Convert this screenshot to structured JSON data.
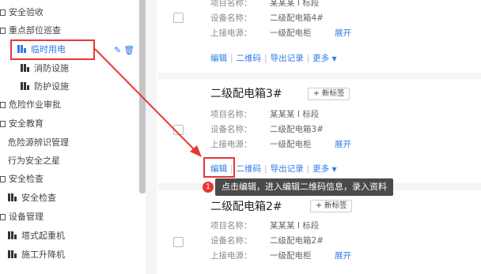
{
  "sidebar": {
    "items": [
      {
        "label": "安全验收",
        "kind": "group"
      },
      {
        "label": "重点部位巡查",
        "kind": "group"
      },
      {
        "label": "临时用电",
        "kind": "sub",
        "active": true
      },
      {
        "label": "消防设施",
        "kind": "sub"
      },
      {
        "label": "防护设施",
        "kind": "sub"
      },
      {
        "label": "危险作业审批",
        "kind": "group"
      },
      {
        "label": "安全教育",
        "kind": "group"
      },
      {
        "label": "危险源辨识管理",
        "kind": "plain"
      },
      {
        "label": "行为安全之星",
        "kind": "plain"
      },
      {
        "label": "安全检查",
        "kind": "group"
      },
      {
        "label": "安全检查",
        "kind": "sub"
      },
      {
        "label": "设备管理",
        "kind": "group"
      },
      {
        "label": "塔式起重机",
        "kind": "sub"
      },
      {
        "label": "施工升降机",
        "kind": "sub"
      }
    ],
    "item_actions": {
      "edit_icon": "pen-icon",
      "delete_icon": "trash-icon"
    }
  },
  "field_labels": {
    "project": "项目名称：",
    "device": "设备名称：",
    "upstream": "上接电源："
  },
  "cards": [
    {
      "title": "",
      "project": "某某某 I 标段",
      "device": "二级配电箱4#",
      "upstream": "一级配电柜",
      "expand": "展开",
      "actions": [
        "编辑",
        "二维码",
        "导出记录",
        "更多"
      ]
    },
    {
      "title": "二级配电箱3#",
      "tag_button": "+ 新标签",
      "project": "某某某 I 标段",
      "device": "二级配电箱3#",
      "upstream": "一级配电柜",
      "expand": "展开",
      "actions": [
        "编辑",
        "二维码",
        "导出记录",
        "更多"
      ]
    },
    {
      "title": "二级配电箱2#",
      "tag_button": "+ 新标签",
      "project": "某某某 I 标段",
      "device": "二级配电箱2#",
      "upstream": "一级配电柜",
      "expand": "展开"
    }
  ],
  "tooltip": {
    "number": "1",
    "text": "点击编辑，进入编辑二维码信息，录入资料"
  },
  "colors": {
    "accent": "#2d7be5",
    "highlight": "#e53935",
    "tooltip_bg": "#4a4a4a"
  }
}
